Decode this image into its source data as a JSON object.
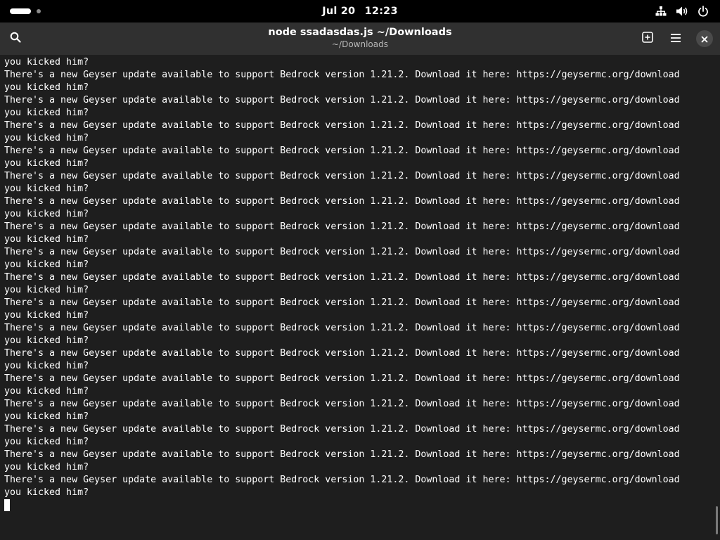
{
  "topbar": {
    "date": "Jul 20",
    "time": "12:23",
    "tray_icons": [
      "network-icon",
      "volume-icon",
      "power-icon"
    ]
  },
  "headerbar": {
    "title": "node ssadasdas.js ~/Downloads",
    "subtitle": "~/Downloads",
    "buttons": [
      "search-icon",
      "new-tab-icon",
      "menu-icon",
      "close-icon"
    ]
  },
  "terminal": {
    "lines": [
      "you kicked him?",
      "There's a new Geyser update available to support Bedrock version 1.21.2. Download it here: https://geysermc.org/download",
      "you kicked him?",
      "There's a new Geyser update available to support Bedrock version 1.21.2. Download it here: https://geysermc.org/download",
      "you kicked him?",
      "There's a new Geyser update available to support Bedrock version 1.21.2. Download it here: https://geysermc.org/download",
      "you kicked him?",
      "There's a new Geyser update available to support Bedrock version 1.21.2. Download it here: https://geysermc.org/download",
      "you kicked him?",
      "There's a new Geyser update available to support Bedrock version 1.21.2. Download it here: https://geysermc.org/download",
      "you kicked him?",
      "There's a new Geyser update available to support Bedrock version 1.21.2. Download it here: https://geysermc.org/download",
      "you kicked him?",
      "There's a new Geyser update available to support Bedrock version 1.21.2. Download it here: https://geysermc.org/download",
      "you kicked him?",
      "There's a new Geyser update available to support Bedrock version 1.21.2. Download it here: https://geysermc.org/download",
      "you kicked him?",
      "There's a new Geyser update available to support Bedrock version 1.21.2. Download it here: https://geysermc.org/download",
      "you kicked him?",
      "There's a new Geyser update available to support Bedrock version 1.21.2. Download it here: https://geysermc.org/download",
      "you kicked him?",
      "There's a new Geyser update available to support Bedrock version 1.21.2. Download it here: https://geysermc.org/download",
      "you kicked him?",
      "There's a new Geyser update available to support Bedrock version 1.21.2. Download it here: https://geysermc.org/download",
      "you kicked him?",
      "There's a new Geyser update available to support Bedrock version 1.21.2. Download it here: https://geysermc.org/download",
      "you kicked him?",
      "There's a new Geyser update available to support Bedrock version 1.21.2. Download it here: https://geysermc.org/download",
      "you kicked him?",
      "There's a new Geyser update available to support Bedrock version 1.21.2. Download it here: https://geysermc.org/download",
      "you kicked him?",
      "There's a new Geyser update available to support Bedrock version 1.21.2. Download it here: https://geysermc.org/download",
      "you kicked him?",
      "There's a new Geyser update available to support Bedrock version 1.21.2. Download it here: https://geysermc.org/download",
      "you kicked him?"
    ]
  }
}
